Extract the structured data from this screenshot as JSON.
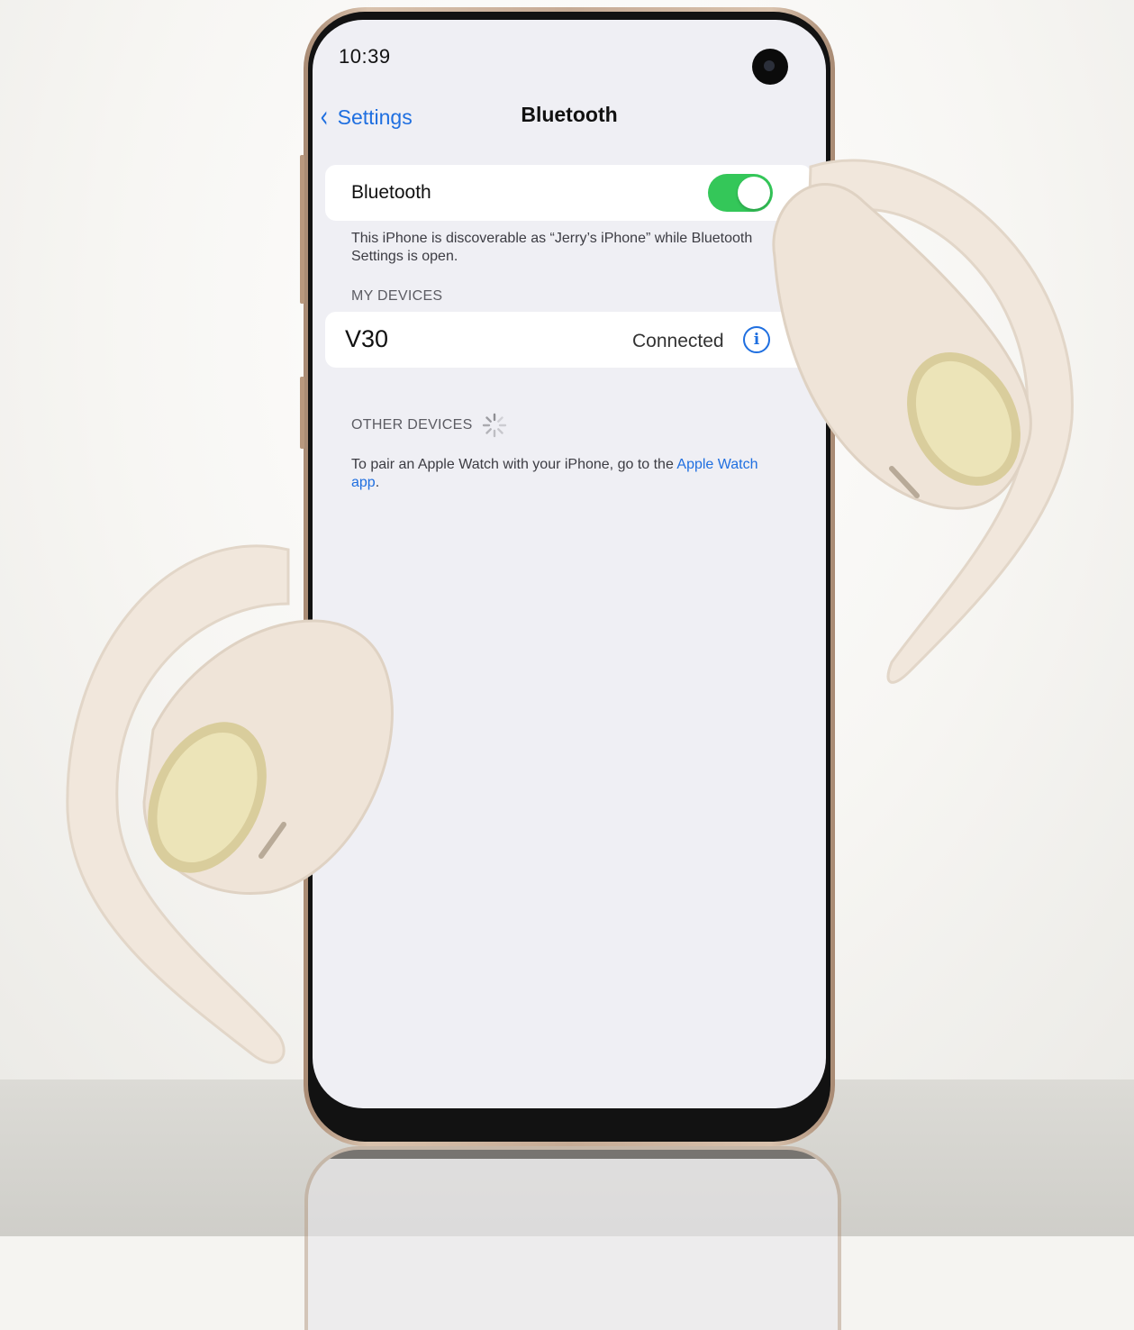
{
  "status_bar": {
    "time": "10:39"
  },
  "nav": {
    "back_label": "Settings",
    "title": "Bluetooth"
  },
  "bluetooth": {
    "label": "Bluetooth",
    "enabled": true,
    "discoverable_note": "This iPhone is discoverable as “Jerry’s iPhone” while Bluetooth Settings is open."
  },
  "my_devices": {
    "header": "MY DEVICES",
    "items": [
      {
        "name": "V30",
        "status": "Connected"
      }
    ]
  },
  "other_devices": {
    "header": "OTHER DEVICES",
    "note_prefix": "To pair an Apple Watch with your iPhone, go to the ",
    "note_link": "Apple Watch app",
    "note_suffix": "."
  },
  "colors": {
    "accent": "#1f6fe0",
    "toggle_on": "#34c759",
    "screen_bg": "#efeff4"
  },
  "icons": [
    "back-chevron-icon",
    "info-icon",
    "spinner-icon",
    "camera-icon"
  ]
}
